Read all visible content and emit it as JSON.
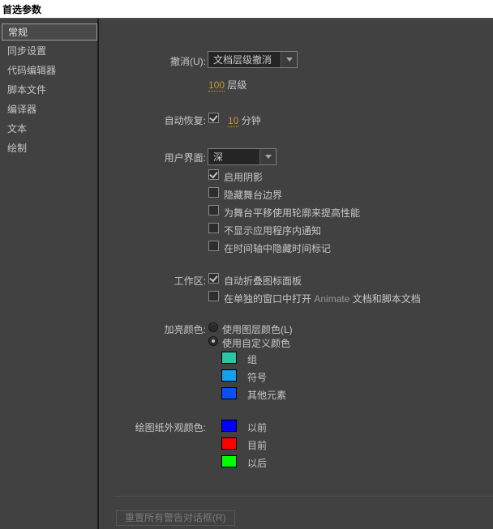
{
  "window": {
    "title": "首选参数"
  },
  "sidebar": {
    "items": [
      {
        "label": "常规",
        "selected": true
      },
      {
        "label": "同步设置",
        "selected": false
      },
      {
        "label": "代码编辑器",
        "selected": false
      },
      {
        "label": "脚本文件",
        "selected": false
      },
      {
        "label": "编译器",
        "selected": false
      },
      {
        "label": "文本",
        "selected": false
      },
      {
        "label": "绘制",
        "selected": false
      }
    ]
  },
  "general": {
    "undo": {
      "label": "撤消(U):",
      "dropdown_value": "文档层级撤消",
      "levels_value": "100",
      "levels_suffix": "层级"
    },
    "auto_recovery": {
      "label": "自动恢复:",
      "checked": true,
      "minutes_value": "10",
      "minutes_suffix": "分钟"
    },
    "ui": {
      "label": "用户界面:",
      "dropdown_value": "深",
      "checkboxes": [
        {
          "label": "启用阴影",
          "checked": true
        },
        {
          "label": "隐藏舞台边界",
          "checked": false
        },
        {
          "label": "为舞台平移使用轮廓来提高性能",
          "checked": false
        },
        {
          "label": "不显示应用程序内通知",
          "checked": false
        },
        {
          "label": "在时间轴中隐藏时间标记",
          "checked": false
        }
      ]
    },
    "workspace": {
      "label": "工作区:",
      "checkbox1": {
        "label": "自动折叠图标面板",
        "checked": true
      },
      "checkbox2": {
        "prefix": "在单独的窗口中打开",
        "brand": "Animate",
        "suffix": "文档和脚本文档",
        "checked": false
      }
    },
    "highlight_color": {
      "label": "加亮颜色:",
      "options": [
        {
          "label": "使用图层颜色(L)",
          "selected": false
        },
        {
          "label": "使用自定义颜色",
          "selected": true
        }
      ],
      "swatches": [
        {
          "label": "组",
          "color": "#2EC3A2"
        },
        {
          "label": "符号",
          "color": "#12A0EF"
        },
        {
          "label": "其他元素",
          "color": "#0B4FF7"
        }
      ]
    },
    "onion_skin": {
      "label": "绘图纸外观颜色:",
      "swatches": [
        {
          "label": "以前",
          "color": "#0000FF"
        },
        {
          "label": "目前",
          "color": "#FF0000"
        },
        {
          "label": "以后",
          "color": "#00FF00"
        }
      ]
    },
    "reset_button_label": "重置所有警告对话框(R)"
  }
}
